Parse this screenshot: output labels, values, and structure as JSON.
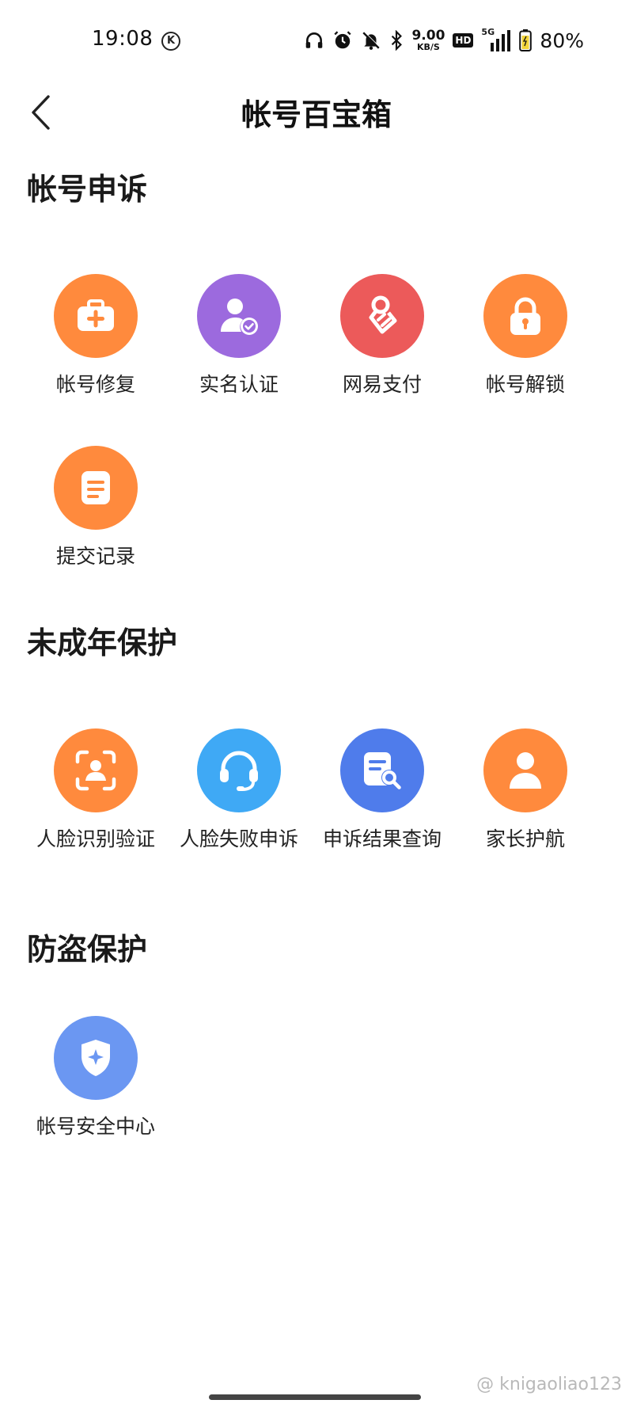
{
  "status_bar": {
    "time": "19:08",
    "carrier_badge": "K",
    "net_speed_value": "9.00",
    "net_speed_unit": "KB/S",
    "hd_label": "HD",
    "signal_label": "5G",
    "battery_percent": "80%"
  },
  "header": {
    "title": "帐号百宝箱"
  },
  "sections": [
    {
      "title": "帐号申诉",
      "items": [
        {
          "label": "帐号修复",
          "icon": "medical-kit-icon",
          "color": "#FF8A3D"
        },
        {
          "label": "实名认证",
          "icon": "user-verified-icon",
          "color": "#9C6ADE"
        },
        {
          "label": "网易支付",
          "icon": "netease-pay-icon",
          "color": "#EC5A5A"
        },
        {
          "label": "帐号解锁",
          "icon": "lock-icon",
          "color": "#FF8A3D"
        },
        {
          "label": "提交记录",
          "icon": "document-icon",
          "color": "#FF8A3D"
        }
      ]
    },
    {
      "title": "未成年保护",
      "items": [
        {
          "label": "人脸识别验证",
          "icon": "face-scan-icon",
          "color": "#FF8A3D"
        },
        {
          "label": "人脸失败申诉",
          "icon": "headset-icon",
          "color": "#3FA9F5"
        },
        {
          "label": "申诉结果查询",
          "icon": "document-search-icon",
          "color": "#4F7CEB"
        },
        {
          "label": "家长护航",
          "icon": "person-icon",
          "color": "#FF8A3D"
        }
      ]
    },
    {
      "title": "防盗保护",
      "items": [
        {
          "label": "帐号安全中心",
          "icon": "shield-star-icon",
          "color": "#6B97F2"
        }
      ]
    }
  ],
  "watermark": "@ knigaoliao123"
}
